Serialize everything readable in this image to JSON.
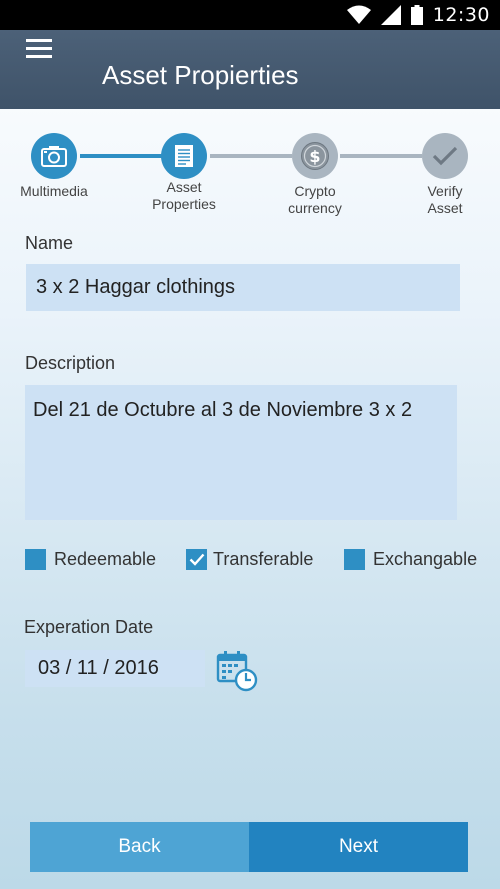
{
  "status_bar": {
    "time": "12:30"
  },
  "app_bar": {
    "title": "Asset Propierties"
  },
  "stepper": {
    "steps": [
      {
        "label_line1": "Multimedia",
        "label_line2": "",
        "icon": "camera-icon",
        "state": "done"
      },
      {
        "label_line1": "Asset",
        "label_line2": "Properties",
        "icon": "document-icon",
        "state": "current"
      },
      {
        "label_line1": "Crypto",
        "label_line2": "currency",
        "icon": "dollar-coin-icon",
        "state": "pending"
      },
      {
        "label_line1": "Verify",
        "label_line2": "Asset",
        "icon": "checkmark-icon",
        "state": "pending"
      }
    ]
  },
  "form": {
    "name_label": "Name",
    "name_value": "3 x 2 Haggar clothings",
    "description_label": "Description",
    "description_value": "Del 21 de Octubre al 3 de Noviembre 3 x 2",
    "options": [
      {
        "label": "Redeemable",
        "checked": false
      },
      {
        "label": "Transferable",
        "checked": true
      },
      {
        "label": "Exchangable",
        "checked": false
      }
    ],
    "expiration_label": "Experation Date",
    "expiration_value": "03 / 11 / 2016"
  },
  "footer": {
    "back_label": "Back",
    "next_label": "Next"
  },
  "colors": {
    "accent": "#2e8fc4",
    "app_bar": "#46596f",
    "input_bg": "#cde1f4",
    "inactive_step": "#a9b5c0"
  }
}
